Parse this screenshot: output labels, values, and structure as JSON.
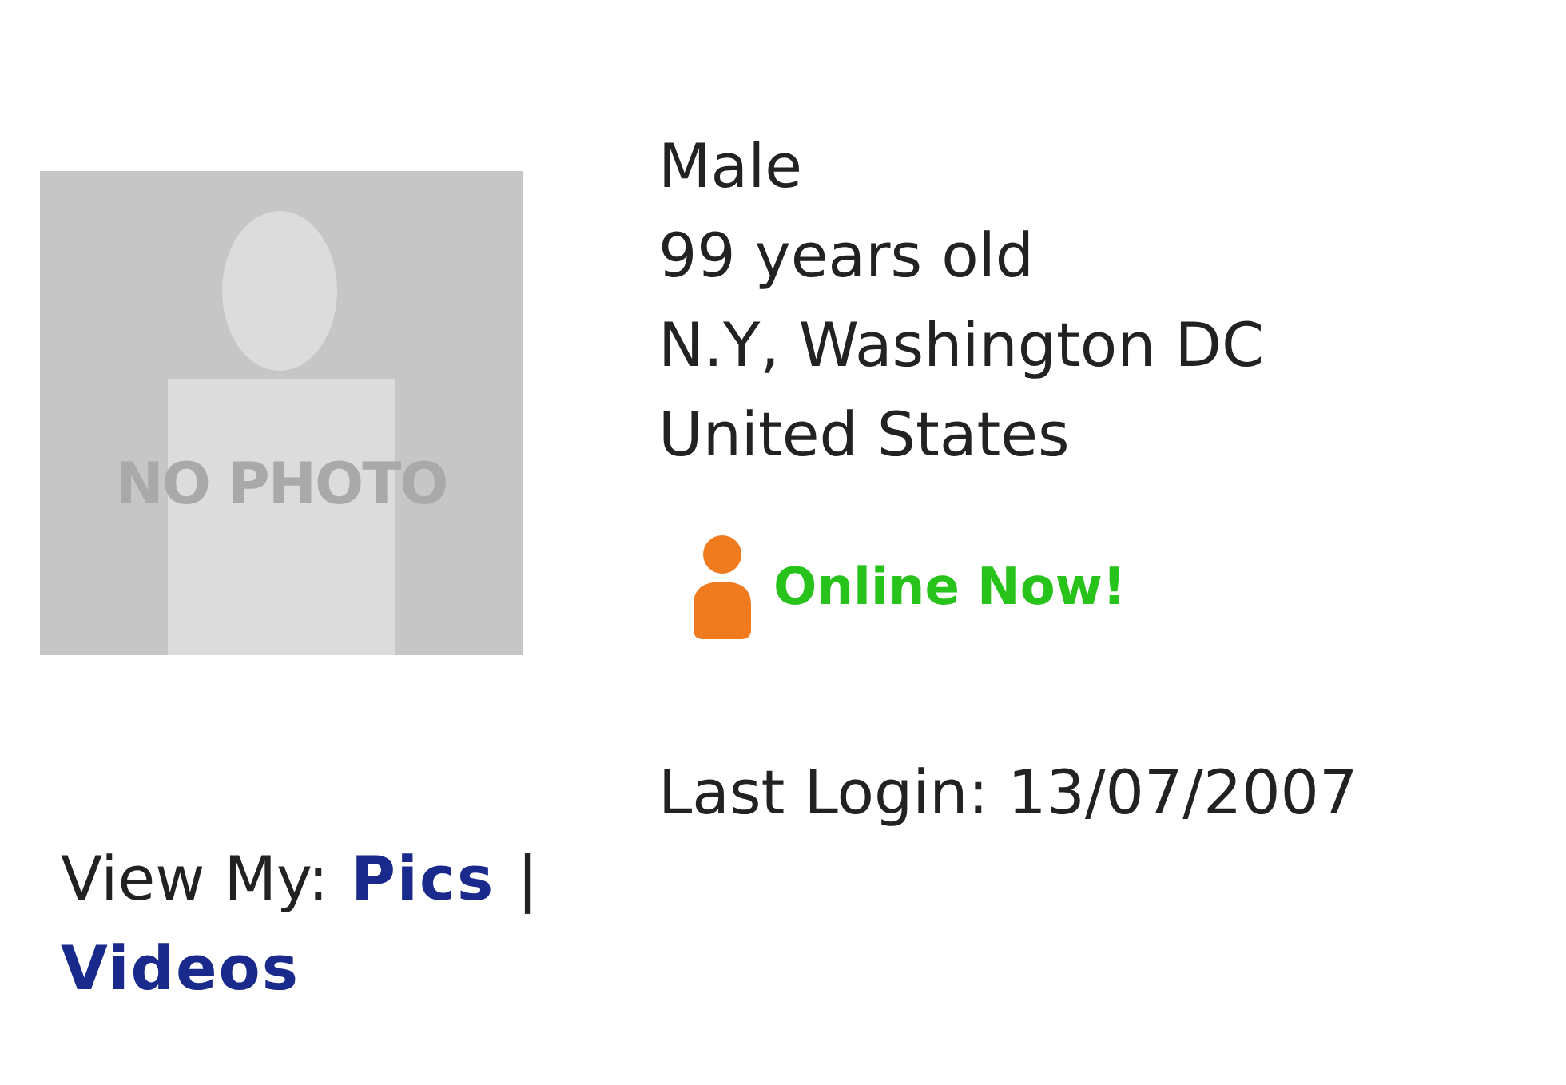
{
  "photo": {
    "kind": "placeholder",
    "label": "NO PHOTO"
  },
  "details": [
    "Male",
    "99 years old",
    "N.Y, Washington DC",
    "United States"
  ],
  "status": {
    "online": true,
    "label": "Online Now!"
  },
  "last_login": "Last Login: 13/07/2007",
  "view_my": {
    "label": "View My:",
    "links": [
      "Pics",
      "Videos"
    ],
    "separator": "|"
  }
}
